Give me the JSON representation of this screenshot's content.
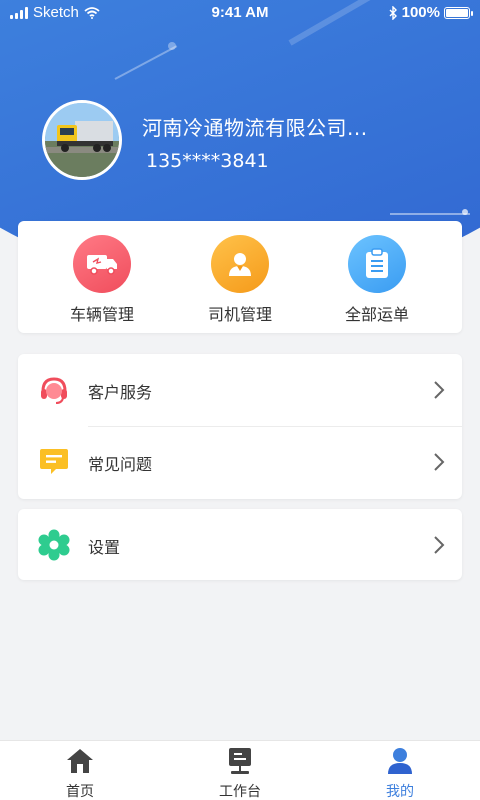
{
  "status_bar": {
    "carrier": "Sketch",
    "time": "9:41 AM",
    "battery": "100%"
  },
  "profile": {
    "company_name": "河南冷通物流有限公司...",
    "phone": "135****3841"
  },
  "quick_actions": [
    {
      "label": "车辆管理",
      "icon": "truck-icon"
    },
    {
      "label": "司机管理",
      "icon": "driver-icon"
    },
    {
      "label": "全部运单",
      "icon": "clipboard-icon"
    }
  ],
  "menu": [
    {
      "label": "客户服务",
      "icon": "headset-icon"
    },
    {
      "label": "常见问题",
      "icon": "message-icon"
    },
    {
      "label": "设置",
      "icon": "gear-icon"
    }
  ],
  "tabbar": [
    {
      "label": "首页",
      "icon": "home-icon"
    },
    {
      "label": "工作台",
      "icon": "workbench-icon"
    },
    {
      "label": "我的",
      "icon": "user-icon",
      "active": true
    }
  ],
  "colors": {
    "primary": "#3d7fdd",
    "red": "#f04d5c",
    "orange": "#f59a1a",
    "blue": "#3a9cf2",
    "green": "#2ecc8f",
    "yellow": "#fbbf24"
  }
}
